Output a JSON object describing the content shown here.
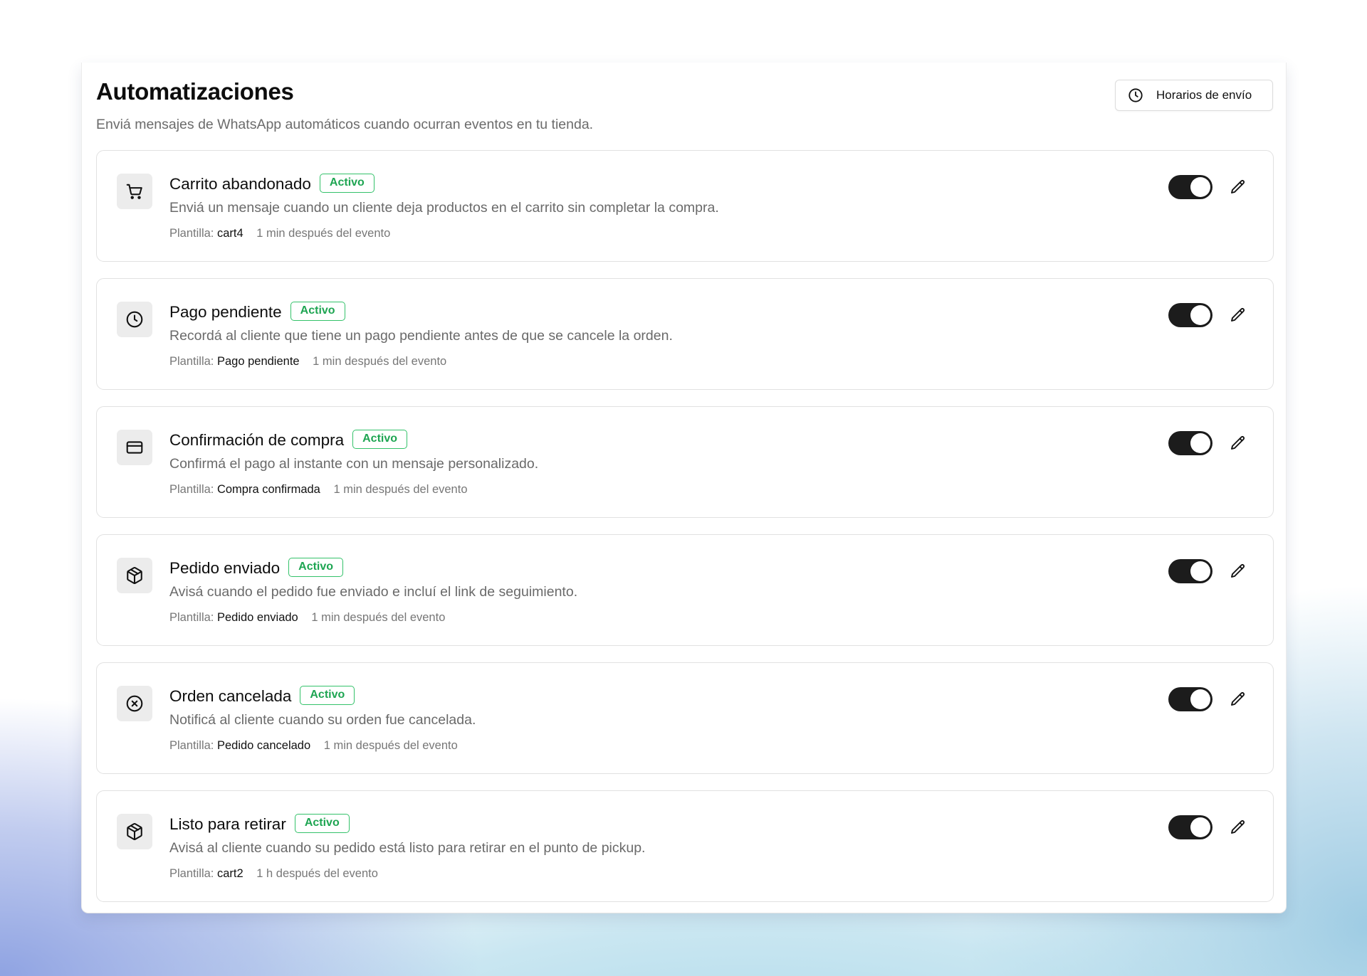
{
  "header": {
    "title": "Automatizaciones",
    "subtitle": "Enviá mensajes de WhatsApp automáticos cuando ocurran eventos en tu tienda.",
    "schedule_button": "Horarios de envío"
  },
  "labels": {
    "template_prefix": "Plantilla:"
  },
  "colors": {
    "active_badge": "#1ea552",
    "toggle_on": "#1c1c1c"
  },
  "automations": [
    {
      "icon": "cart-icon",
      "name": "Carrito abandonado",
      "status": "Activo",
      "description": "Enviá un mensaje cuando un cliente deja productos en el carrito sin completar la compra.",
      "template": "cart4",
      "delay": "1 min después del evento",
      "enabled": true
    },
    {
      "icon": "clock-icon",
      "name": "Pago pendiente",
      "status": "Activo",
      "description": "Recordá al cliente que tiene un pago pendiente antes de que se cancele la orden.",
      "template": "Pago pendiente",
      "delay": "1 min después del evento",
      "enabled": true
    },
    {
      "icon": "credit-card-icon",
      "name": "Confirmación de compra",
      "status": "Activo",
      "description": "Confirmá el pago al instante con un mensaje personalizado.",
      "template": "Compra confirmada",
      "delay": "1 min después del evento",
      "enabled": true
    },
    {
      "icon": "package-icon",
      "name": "Pedido enviado",
      "status": "Activo",
      "description": "Avisá cuando el pedido fue enviado e incluí el link de seguimiento.",
      "template": "Pedido enviado",
      "delay": "1 min después del evento",
      "enabled": true
    },
    {
      "icon": "x-circle-icon",
      "name": "Orden cancelada",
      "status": "Activo",
      "description": "Notificá al cliente cuando su orden fue cancelada.",
      "template": "Pedido cancelado",
      "delay": "1 min después del evento",
      "enabled": true
    },
    {
      "icon": "package-icon",
      "name": "Listo para retirar",
      "status": "Activo",
      "description": "Avisá al cliente cuando su pedido está listo para retirar en el punto de pickup.",
      "template": "cart2",
      "delay": "1 h después del evento",
      "enabled": true
    }
  ]
}
